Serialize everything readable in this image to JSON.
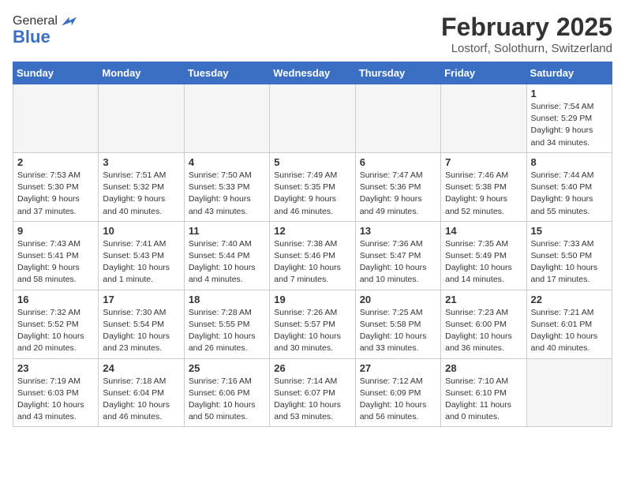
{
  "header": {
    "logo_line1": "General",
    "logo_line2": "Blue",
    "month_title": "February 2025",
    "location": "Lostorf, Solothurn, Switzerland"
  },
  "days_of_week": [
    "Sunday",
    "Monday",
    "Tuesday",
    "Wednesday",
    "Thursday",
    "Friday",
    "Saturday"
  ],
  "weeks": [
    [
      {
        "day": "",
        "info": "",
        "empty": true
      },
      {
        "day": "",
        "info": "",
        "empty": true
      },
      {
        "day": "",
        "info": "",
        "empty": true
      },
      {
        "day": "",
        "info": "",
        "empty": true
      },
      {
        "day": "",
        "info": "",
        "empty": true
      },
      {
        "day": "",
        "info": "",
        "empty": true
      },
      {
        "day": "1",
        "info": "Sunrise: 7:54 AM\nSunset: 5:29 PM\nDaylight: 9 hours and 34 minutes.",
        "empty": false
      }
    ],
    [
      {
        "day": "2",
        "info": "Sunrise: 7:53 AM\nSunset: 5:30 PM\nDaylight: 9 hours and 37 minutes.",
        "empty": false
      },
      {
        "day": "3",
        "info": "Sunrise: 7:51 AM\nSunset: 5:32 PM\nDaylight: 9 hours and 40 minutes.",
        "empty": false
      },
      {
        "day": "4",
        "info": "Sunrise: 7:50 AM\nSunset: 5:33 PM\nDaylight: 9 hours and 43 minutes.",
        "empty": false
      },
      {
        "day": "5",
        "info": "Sunrise: 7:49 AM\nSunset: 5:35 PM\nDaylight: 9 hours and 46 minutes.",
        "empty": false
      },
      {
        "day": "6",
        "info": "Sunrise: 7:47 AM\nSunset: 5:36 PM\nDaylight: 9 hours and 49 minutes.",
        "empty": false
      },
      {
        "day": "7",
        "info": "Sunrise: 7:46 AM\nSunset: 5:38 PM\nDaylight: 9 hours and 52 minutes.",
        "empty": false
      },
      {
        "day": "8",
        "info": "Sunrise: 7:44 AM\nSunset: 5:40 PM\nDaylight: 9 hours and 55 minutes.",
        "empty": false
      }
    ],
    [
      {
        "day": "9",
        "info": "Sunrise: 7:43 AM\nSunset: 5:41 PM\nDaylight: 9 hours and 58 minutes.",
        "empty": false
      },
      {
        "day": "10",
        "info": "Sunrise: 7:41 AM\nSunset: 5:43 PM\nDaylight: 10 hours and 1 minute.",
        "empty": false
      },
      {
        "day": "11",
        "info": "Sunrise: 7:40 AM\nSunset: 5:44 PM\nDaylight: 10 hours and 4 minutes.",
        "empty": false
      },
      {
        "day": "12",
        "info": "Sunrise: 7:38 AM\nSunset: 5:46 PM\nDaylight: 10 hours and 7 minutes.",
        "empty": false
      },
      {
        "day": "13",
        "info": "Sunrise: 7:36 AM\nSunset: 5:47 PM\nDaylight: 10 hours and 10 minutes.",
        "empty": false
      },
      {
        "day": "14",
        "info": "Sunrise: 7:35 AM\nSunset: 5:49 PM\nDaylight: 10 hours and 14 minutes.",
        "empty": false
      },
      {
        "day": "15",
        "info": "Sunrise: 7:33 AM\nSunset: 5:50 PM\nDaylight: 10 hours and 17 minutes.",
        "empty": false
      }
    ],
    [
      {
        "day": "16",
        "info": "Sunrise: 7:32 AM\nSunset: 5:52 PM\nDaylight: 10 hours and 20 minutes.",
        "empty": false
      },
      {
        "day": "17",
        "info": "Sunrise: 7:30 AM\nSunset: 5:54 PM\nDaylight: 10 hours and 23 minutes.",
        "empty": false
      },
      {
        "day": "18",
        "info": "Sunrise: 7:28 AM\nSunset: 5:55 PM\nDaylight: 10 hours and 26 minutes.",
        "empty": false
      },
      {
        "day": "19",
        "info": "Sunrise: 7:26 AM\nSunset: 5:57 PM\nDaylight: 10 hours and 30 minutes.",
        "empty": false
      },
      {
        "day": "20",
        "info": "Sunrise: 7:25 AM\nSunset: 5:58 PM\nDaylight: 10 hours and 33 minutes.",
        "empty": false
      },
      {
        "day": "21",
        "info": "Sunrise: 7:23 AM\nSunset: 6:00 PM\nDaylight: 10 hours and 36 minutes.",
        "empty": false
      },
      {
        "day": "22",
        "info": "Sunrise: 7:21 AM\nSunset: 6:01 PM\nDaylight: 10 hours and 40 minutes.",
        "empty": false
      }
    ],
    [
      {
        "day": "23",
        "info": "Sunrise: 7:19 AM\nSunset: 6:03 PM\nDaylight: 10 hours and 43 minutes.",
        "empty": false
      },
      {
        "day": "24",
        "info": "Sunrise: 7:18 AM\nSunset: 6:04 PM\nDaylight: 10 hours and 46 minutes.",
        "empty": false
      },
      {
        "day": "25",
        "info": "Sunrise: 7:16 AM\nSunset: 6:06 PM\nDaylight: 10 hours and 50 minutes.",
        "empty": false
      },
      {
        "day": "26",
        "info": "Sunrise: 7:14 AM\nSunset: 6:07 PM\nDaylight: 10 hours and 53 minutes.",
        "empty": false
      },
      {
        "day": "27",
        "info": "Sunrise: 7:12 AM\nSunset: 6:09 PM\nDaylight: 10 hours and 56 minutes.",
        "empty": false
      },
      {
        "day": "28",
        "info": "Sunrise: 7:10 AM\nSunset: 6:10 PM\nDaylight: 11 hours and 0 minutes.",
        "empty": false
      },
      {
        "day": "",
        "info": "",
        "empty": true
      }
    ]
  ]
}
